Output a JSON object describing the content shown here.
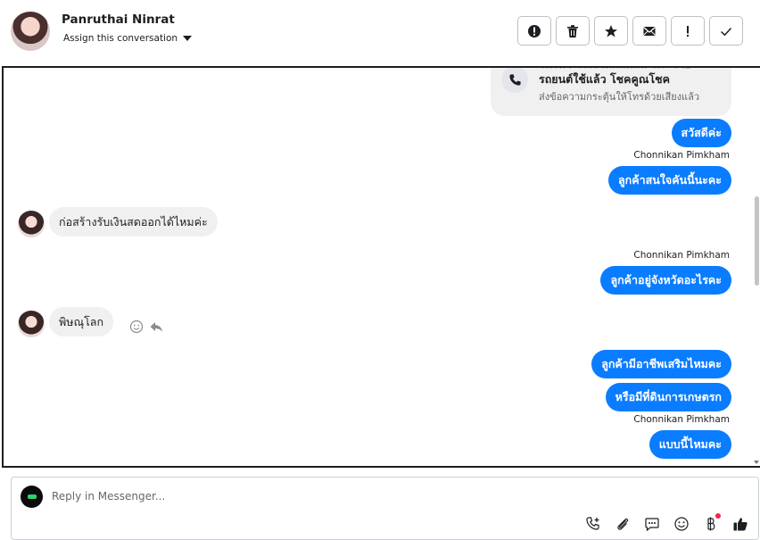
{
  "header": {
    "contact_name": "Panruthai Ninrat",
    "assign_label": "Assign this conversation",
    "actions": [
      {
        "name": "spam-button",
        "icon": "alert-circle-icon"
      },
      {
        "name": "delete-button",
        "icon": "trash-icon"
      },
      {
        "name": "star-button",
        "icon": "star-icon"
      },
      {
        "name": "mark-unread-button",
        "icon": "envelope-icon"
      },
      {
        "name": "important-button",
        "icon": "exclamation-icon"
      },
      {
        "name": "done-button",
        "icon": "check-icon"
      }
    ]
  },
  "conversation": {
    "call_card": {
      "title_line1": "โทรหา โรงงานผลิตและกระจาย",
      "title_line2": "รถยนต์ใช้แล้ว โชคคูณโชค",
      "subtitle": "ส่งข้อความกระตุ้นให้โทรด้วยเสียงแล้ว"
    },
    "messages": [
      {
        "direction": "out",
        "text": "สวัสดีค่ะ"
      },
      {
        "direction": "out",
        "sender": "Chonnikan Pimkham",
        "text": "ลูกค้าสนใจคันนี้นะคะ"
      },
      {
        "direction": "in",
        "text": "ก่อสร้างรับเงินสดออกได้ไหมค่ะ"
      },
      {
        "direction": "out",
        "sender": "Chonnikan Pimkham",
        "text": "ลูกค้าอยู่จังหวัดอะไรคะ"
      },
      {
        "direction": "in",
        "text": "พิษณุโลก"
      },
      {
        "direction": "out",
        "text": "ลูกค้ามีอาชีพเสริมไหมคะ"
      },
      {
        "direction": "out",
        "text": "หรือมีที่ดินการเกษตรก"
      },
      {
        "direction": "out",
        "sender": "Chonnikan Pimkham",
        "text": "แบบนี้ไหมคะ"
      }
    ]
  },
  "composer": {
    "placeholder": "Reply in Messenger...",
    "icons": [
      "call-add-icon",
      "attachment-icon",
      "saved-replies-icon",
      "emoji-icon",
      "currency-icon",
      "thumbs-up-icon"
    ]
  },
  "colors": {
    "accent": "#0a7cff",
    "incoming_bubble": "#f0f0f0",
    "notification_dot": "#f02849"
  }
}
